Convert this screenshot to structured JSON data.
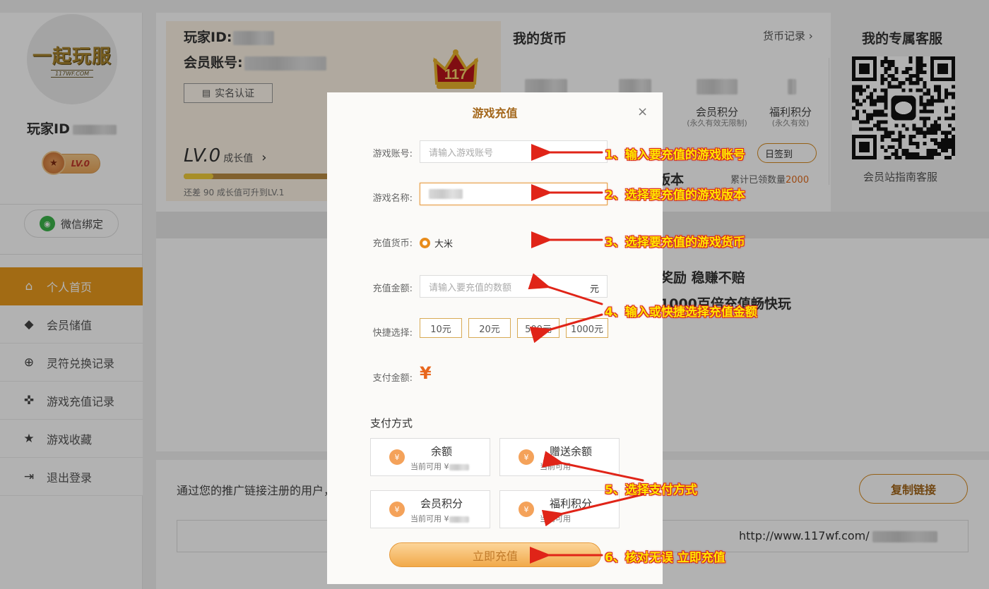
{
  "sidebar": {
    "logo_text": "一起玩服",
    "logo_sub": "117WF.COM",
    "player_id_label": "玩家ID",
    "level_badge": "LV.0",
    "wechat_bind": "微信绑定",
    "nav": [
      {
        "label": "个人首页",
        "icon": "home-icon",
        "active": true
      },
      {
        "label": "会员储值",
        "icon": "diamond-icon"
      },
      {
        "label": "灵符兑换记录",
        "icon": "talisman-icon"
      },
      {
        "label": "游戏充值记录",
        "icon": "gamepad-icon"
      },
      {
        "label": "游戏收藏",
        "icon": "star-icon"
      },
      {
        "label": "退出登录",
        "icon": "logout-icon"
      }
    ]
  },
  "profile": {
    "player_id_label": "玩家ID:",
    "account_label": "会员账号:",
    "realname_button": "实名认证",
    "level": "LV.0",
    "growth_label": "成长值",
    "growth_arrow": "›",
    "growth_progress": 0.2,
    "growth_note": "还差 90 成长值可升到LV.1"
  },
  "currency": {
    "title": "我的货币",
    "record_link": "货币记录",
    "member_points": "会员积分",
    "member_points_sub": "(永久有效无限制)",
    "welfare_points": "福利积分",
    "welfare_points_sub": "(永久有效)",
    "sign_in": "日签到",
    "cumulative_label": "累计已领数量",
    "cumulative_value": "2000",
    "partial_version": "版本",
    "partial_promo1": "奖励 稳赚不赔",
    "partial_promo2": "1000百倍充值畅快玩"
  },
  "service": {
    "title": "我的专属客服",
    "subtitle": "会员站指南客服"
  },
  "promo": {
    "text": "通过您的推广链接注册的用户，",
    "copy_button": "复制链接",
    "link_prefix": "http://www.117wf.com/"
  },
  "modal": {
    "title": "游戏充值",
    "close": "×",
    "account_label": "游戏账号:",
    "account_placeholder": "请输入游戏账号",
    "game_label": "游戏名称:",
    "currency_label": "充值货币:",
    "currency_option": "大米",
    "amount_label": "充值金额:",
    "amount_placeholder": "请输入要充值的数额",
    "amount_unit": "元",
    "quick_label": "快捷选择:",
    "quick_options": [
      "10元",
      "20元",
      "500元",
      "1000元"
    ],
    "pay_amount_label": "支付金额:",
    "pay_symbol": "¥",
    "pay_method_title": "支付方式",
    "pay_methods": [
      {
        "name": "余额",
        "avail": "当前可用 ¥"
      },
      {
        "name": "赠送余额",
        "avail": "当前可用"
      },
      {
        "name": "会员积分",
        "avail": "当前可用 ¥"
      },
      {
        "name": "福利积分",
        "avail": "当前可用"
      }
    ],
    "submit": "立即充值"
  },
  "annotations": [
    "1、输入要充值的游戏账号",
    "2、选择要充值的游戏版本",
    "3、选择要充值的游戏货币",
    "4、输入或快捷选择充值金额",
    "5、选择支付方式",
    "6、核对无误 立即充值"
  ],
  "colors": {
    "accent": "#e89a1e",
    "annotation_text": "#ffe600",
    "annotation_stroke": "#d9261c",
    "price": "#e8661c"
  }
}
